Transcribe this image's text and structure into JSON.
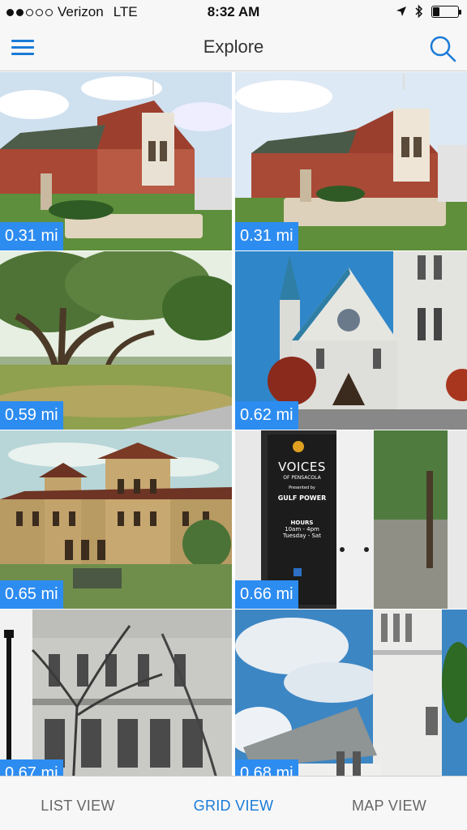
{
  "status_bar": {
    "carrier": "Verizon",
    "network": "LTE",
    "time": "8:32 AM",
    "signal_bars_filled": 2,
    "signal_bars_total": 5,
    "battery_level": 0.25,
    "icons": [
      "location-arrow-icon",
      "bluetooth-icon",
      "battery-icon"
    ]
  },
  "navbar": {
    "title": "Explore",
    "menu_icon": "hamburger-menu-icon",
    "search_icon": "search-icon",
    "accent_color": "#1a7bd8"
  },
  "tiles": [
    {
      "distance": "0.31 mi",
      "scene": "red-brick-church"
    },
    {
      "distance": "0.31 mi",
      "scene": "red-brick-church-alt"
    },
    {
      "distance": "0.59 mi",
      "scene": "park-oak-trees"
    },
    {
      "distance": "0.62 mi",
      "scene": "white-cathedral"
    },
    {
      "distance": "0.65 mi",
      "scene": "historic-museum-postcard"
    },
    {
      "distance": "0.66 mi",
      "scene": "museum-glass-door"
    },
    {
      "distance": "0.67 mi",
      "scene": "historic-bw-building"
    },
    {
      "distance": "0.68 mi",
      "scene": "white-chapel-steeple"
    }
  ],
  "door_sign": {
    "title": "VOICES",
    "subtitle": "OF PENSACOLA",
    "presented": "Presented by",
    "sponsor": "GULF POWER",
    "hours_title": "HOURS",
    "hours": "10am - 4pm",
    "days": "Tuesday - Sat"
  },
  "tabs": [
    {
      "label": "LIST VIEW",
      "active": false
    },
    {
      "label": "GRID VIEW",
      "active": true
    },
    {
      "label": "MAP VIEW",
      "active": false
    }
  ],
  "badge_color": "#2d8cf0"
}
